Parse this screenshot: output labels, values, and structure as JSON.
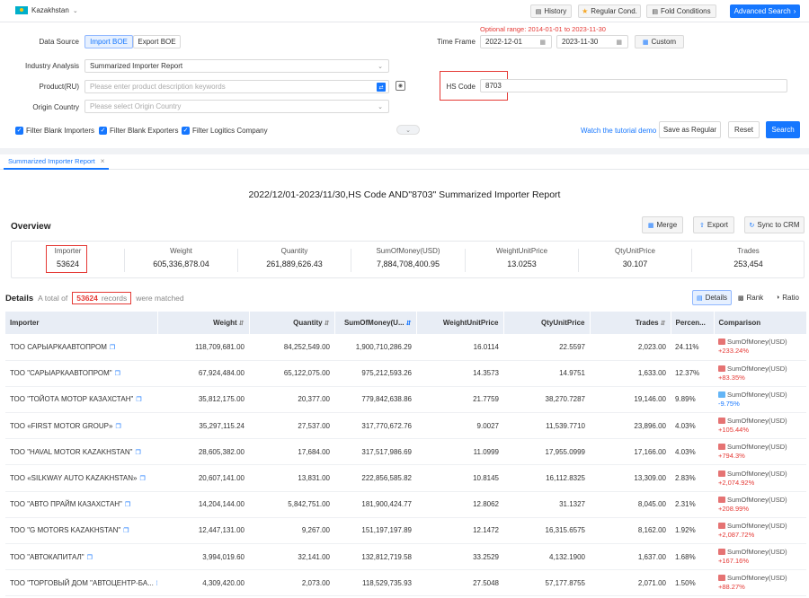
{
  "topbar": {
    "country": "Kazakhstan",
    "history": "History",
    "regular_cond": "Regular Cond.",
    "fold_conditions": "Fold Conditions",
    "advanced_search": "Advanced Search"
  },
  "filters": {
    "data_source_label": "Data Source",
    "import_boe": "Import BOE",
    "export_boe": "Export BOE",
    "optional_range": "Optional range: 2014-01-01 to 2023-11-30",
    "time_frame_label": "Time Frame",
    "date_from": "2022-12-01",
    "date_to": "2023-11-30",
    "custom": "Custom",
    "industry_label": "Industry Analysis",
    "industry_value": "Summarized Importer Report",
    "product_label": "Product(RU)",
    "product_placeholder": "Please enter product description keywords",
    "hs_label": "HS Code",
    "hs_value": "8703",
    "origin_label": "Origin Country",
    "origin_placeholder": "Please select Origin Country",
    "filter_blank_importers": "Filter Blank Importers",
    "filter_blank_exporters": "Filter Blank Exporters",
    "filter_logistics": "Filter Logitics Company",
    "tutorial": "Watch the tutorial demo",
    "save_regular": "Save as Regular",
    "reset": "Reset",
    "search": "Search"
  },
  "tab": {
    "label": "Summarized Importer Report"
  },
  "report": {
    "title": "2022/12/01-2023/11/30,HS Code AND\"8703\" Summarized Importer Report",
    "overview": "Overview",
    "merge": "Merge",
    "export": "Export",
    "sync": "Sync to CRM",
    "stats": [
      {
        "key": "Importer",
        "value": "53624"
      },
      {
        "key": "Weight",
        "value": "605,336,878.04"
      },
      {
        "key": "Quantity",
        "value": "261,889,626.43"
      },
      {
        "key": "SumOfMoney(USD)",
        "value": "7,884,708,400.95"
      },
      {
        "key": "WeightUnitPrice",
        "value": "13.0253"
      },
      {
        "key": "QtyUnitPrice",
        "value": "30.107"
      },
      {
        "key": "Trades",
        "value": "253,454"
      }
    ],
    "details": "Details",
    "total_prefix": "A total of",
    "total_count": "53624",
    "records": "records",
    "matched": "were matched",
    "view_details": "Details",
    "view_rank": "Rank",
    "view_ratio": "Ratio"
  },
  "table": {
    "headers": [
      "Importer",
      "Weight",
      "Quantity",
      "SumOfMoney(U...",
      "WeightUnitPrice",
      "QtyUnitPrice",
      "Trades",
      "Percen...",
      "Comparison"
    ],
    "rows": [
      {
        "importer": "ТОО САРЫАРКААВТОПРОМ",
        "weight": "118,709,681.00",
        "qty": "84,252,549.00",
        "money": "1,900,710,286.29",
        "wup": "16.0114",
        "qup": "22.5597",
        "trades": "2,023.00",
        "pct": "24.11%",
        "cmp_label": "SumOfMoney(USD)",
        "cmp": "+233.24%",
        "dir": "up"
      },
      {
        "importer": "ТОО \"САРЫАРКААВТОПРОМ\"",
        "weight": "67,924,484.00",
        "qty": "65,122,075.00",
        "money": "975,212,593.26",
        "wup": "14.3573",
        "qup": "14.9751",
        "trades": "1,633.00",
        "pct": "12.37%",
        "cmp_label": "SumOfMoney(USD)",
        "cmp": "+83.35%",
        "dir": "up"
      },
      {
        "importer": "ТОО \"ТОЙОТА МОТОР КАЗАХСТАН\"",
        "weight": "35,812,175.00",
        "qty": "20,377.00",
        "money": "779,842,638.86",
        "wup": "21.7759",
        "qup": "38,270.7287",
        "trades": "19,146.00",
        "pct": "9.89%",
        "cmp_label": "SumOfMoney(USD)",
        "cmp": "-9.75%",
        "dir": "down"
      },
      {
        "importer": "ТОО «FIRST MOTOR GROUP»",
        "weight": "35,297,115.24",
        "qty": "27,537.00",
        "money": "317,770,672.76",
        "wup": "9.0027",
        "qup": "11,539.7710",
        "trades": "23,896.00",
        "pct": "4.03%",
        "cmp_label": "SumOfMoney(USD)",
        "cmp": "+105.44%",
        "dir": "up"
      },
      {
        "importer": "ТОО \"HAVAL MOTOR KAZAKHSTAN\"",
        "weight": "28,605,382.00",
        "qty": "17,684.00",
        "money": "317,517,986.69",
        "wup": "11.0999",
        "qup": "17,955.0999",
        "trades": "17,166.00",
        "pct": "4.03%",
        "cmp_label": "SumOfMoney(USD)",
        "cmp": "+794.3%",
        "dir": "up"
      },
      {
        "importer": "ТОО «SILKWAY AUTO KAZAKHSTAN»",
        "weight": "20,607,141.00",
        "qty": "13,831.00",
        "money": "222,856,585.82",
        "wup": "10.8145",
        "qup": "16,112.8325",
        "trades": "13,309.00",
        "pct": "2.83%",
        "cmp_label": "SumOfMoney(USD)",
        "cmp": "+2,074.92%",
        "dir": "up"
      },
      {
        "importer": "ТОО \"АВТО ПРАЙМ КАЗАХСТАН\"",
        "weight": "14,204,144.00",
        "qty": "5,842,751.00",
        "money": "181,900,424.77",
        "wup": "12.8062",
        "qup": "31.1327",
        "trades": "8,045.00",
        "pct": "2.31%",
        "cmp_label": "SumOfMoney(USD)",
        "cmp": "+208.99%",
        "dir": "up"
      },
      {
        "importer": "ТОО \"G MOTORS KAZAKHSTAN\"",
        "weight": "12,447,131.00",
        "qty": "9,267.00",
        "money": "151,197,197.89",
        "wup": "12.1472",
        "qup": "16,315.6575",
        "trades": "8,162.00",
        "pct": "1.92%",
        "cmp_label": "SumOfMoney(USD)",
        "cmp": "+2,087.72%",
        "dir": "up"
      },
      {
        "importer": "ТОО \"АВТОКАПИТАЛ\"",
        "weight": "3,994,019.60",
        "qty": "32,141.00",
        "money": "132,812,719.58",
        "wup": "33.2529",
        "qup": "4,132.1900",
        "trades": "1,637.00",
        "pct": "1.68%",
        "cmp_label": "SumOfMoney(USD)",
        "cmp": "+167.16%",
        "dir": "up"
      },
      {
        "importer": "ТОО \"ТОРГОВЫЙ ДОМ \"АВТОЦЕНТР-БА...",
        "weight": "4,309,420.00",
        "qty": "2,073.00",
        "money": "118,529,735.93",
        "wup": "27.5048",
        "qup": "57,177.8755",
        "trades": "2,071.00",
        "pct": "1.50%",
        "cmp_label": "SumOfMoney(USD)",
        "cmp": "+88.27%",
        "dir": "up"
      }
    ]
  },
  "colors": {
    "primary": "#1677ff",
    "highlight": "#e53935",
    "positive": "#e53935",
    "negative": "#1677ff"
  }
}
